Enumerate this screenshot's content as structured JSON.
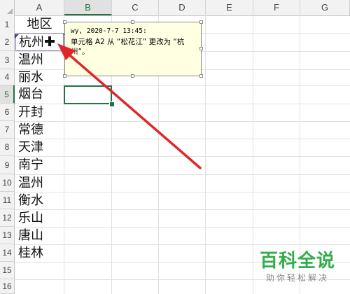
{
  "columns": [
    "A",
    "B",
    "C",
    "D",
    "E",
    "F",
    "G"
  ],
  "rows": [
    "1",
    "2",
    "3",
    "4",
    "5",
    "6",
    "7",
    "8",
    "9",
    "10",
    "11",
    "12",
    "13",
    "14",
    "15",
    "16"
  ],
  "active_column": "B",
  "active_row": "5",
  "cells_a": [
    "地区",
    "杭州",
    "温州",
    "丽水",
    "烟台",
    "开封",
    "常德",
    "天津",
    "南宁",
    "温州",
    "衡水",
    "乐山",
    "唐山",
    "桂林"
  ],
  "comment": {
    "author": "wy, 2020-7-7 13:45:",
    "text": "单元格 A2 从 “松花江” 更改为 “杭州”。"
  },
  "colors": {
    "accent": "#217346",
    "arrow": "#e0262b",
    "comment_bg": "#ffffe1",
    "watermark": "#2fae4a"
  },
  "watermark": {
    "title": "百科全说",
    "subtitle": "助你轻松解决"
  }
}
